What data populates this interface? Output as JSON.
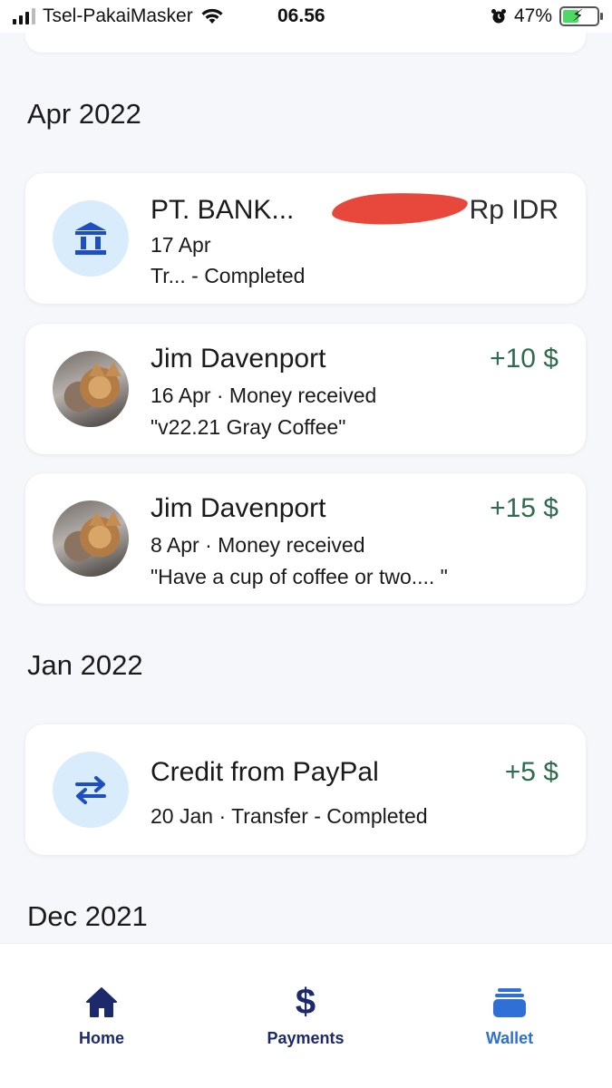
{
  "status_bar": {
    "carrier": "Tsel-PakaiMasker",
    "time": "06.56",
    "battery": "47%"
  },
  "sections": [
    {
      "heading": "Apr 2022",
      "transactions": [
        {
          "name": "PT. BANK...",
          "date": "17 Apr",
          "detail": "Tr...  - Completed",
          "amount": "Rp IDR",
          "icon": "bank-icon"
        },
        {
          "name": "Jim Davenport",
          "date_line": "16 Apr · Money received",
          "note": "\"v22.21 Gray Coffee\"",
          "amount": "+10 $",
          "icon": "avatar-photo"
        },
        {
          "name": "Jim Davenport",
          "date_line": "8 Apr · Money received",
          "note": "\"Have a cup of coffee or two.... \"",
          "amount": "+15 $",
          "icon": "avatar-photo"
        }
      ]
    },
    {
      "heading": "Jan 2022",
      "transactions": [
        {
          "name": "Credit from PayPal",
          "date_line": "20 Jan · Transfer - Completed",
          "amount": "+5 $",
          "icon": "transfer-arrows-icon"
        }
      ]
    },
    {
      "heading": "Dec 2021",
      "transactions": []
    }
  ],
  "bottom_nav": {
    "items": [
      {
        "label": "Home",
        "icon": "home-icon",
        "active": false
      },
      {
        "label": "Payments",
        "icon": "dollar-icon",
        "active": false
      },
      {
        "label": "Wallet",
        "icon": "wallet-icon",
        "active": true
      }
    ]
  },
  "colors": {
    "positive_amount": "#2f6b4f",
    "nav_dark": "#1c2a6b",
    "nav_active": "#2f6fd6",
    "icon_bg": "#d8ecfb",
    "icon_blue": "#1f4fbf"
  }
}
